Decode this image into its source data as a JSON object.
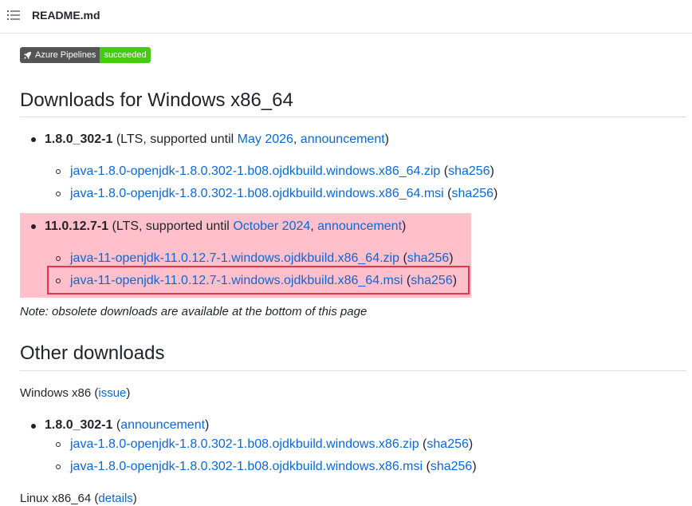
{
  "header": {
    "title": "README.md",
    "icon": "list-icon"
  },
  "badge": {
    "left": "Azure Pipelines",
    "right": "succeeded",
    "left_color": "#555555",
    "right_color": "#44cc11"
  },
  "windows64": {
    "heading": "Downloads for Windows x86_64",
    "items": [
      {
        "version": "1.8.0_302-1",
        "text1": " (LTS, supported until ",
        "eol": "May 2026",
        "sep": ", ",
        "announcement": "announcement",
        "close": ")",
        "files": [
          {
            "name": "java-1.8.0-openjdk-1.8.0.302-1.b08.ojdkbuild.windows.x86_64.zip",
            "open": " (",
            "hash": "sha256",
            "close": ")"
          },
          {
            "name": "java-1.8.0-openjdk-1.8.0.302-1.b08.ojdkbuild.windows.x86_64.msi",
            "open": " (",
            "hash": "sha256",
            "close": ")"
          }
        ]
      },
      {
        "version": "11.0.12.7-1",
        "text1": " (LTS, supported until ",
        "eol": "October 2024",
        "sep": ", ",
        "announcement": "announcement",
        "close": ")",
        "files": [
          {
            "name": "java-11-openjdk-11.0.12.7-1.windows.ojdkbuild.x86_64.zip",
            "open": " (",
            "hash": "sha256",
            "close": ")"
          },
          {
            "name": "java-11-openjdk-11.0.12.7-1.windows.ojdkbuild.x86_64.msi",
            "open": " (",
            "hash": "sha256",
            "close": ")"
          }
        ]
      }
    ],
    "highlight_color": "#ffc0cb",
    "selection_color": "#e8334a"
  },
  "note": "Note: obsolete downloads are available at the bottom of this page",
  "other": {
    "heading": "Other downloads",
    "win86": {
      "label": "Windows x86",
      "open": " (",
      "link": "issue",
      "close": ")",
      "item": {
        "version": "1.8.0_302-1",
        "open": " (",
        "announcement": "announcement",
        "close": ")",
        "files": [
          {
            "name": "java-1.8.0-openjdk-1.8.0.302-1.b08.ojdkbuild.windows.x86.zip",
            "open": " (",
            "hash": "sha256",
            "close": ")"
          },
          {
            "name": "java-1.8.0-openjdk-1.8.0.302-1.b08.ojdkbuild.windows.x86.msi",
            "open": " (",
            "hash": "sha256",
            "close": ")"
          }
        ]
      }
    },
    "linux": {
      "label": "Linux x86_64",
      "open": " (",
      "link": "details",
      "close": ")"
    }
  }
}
